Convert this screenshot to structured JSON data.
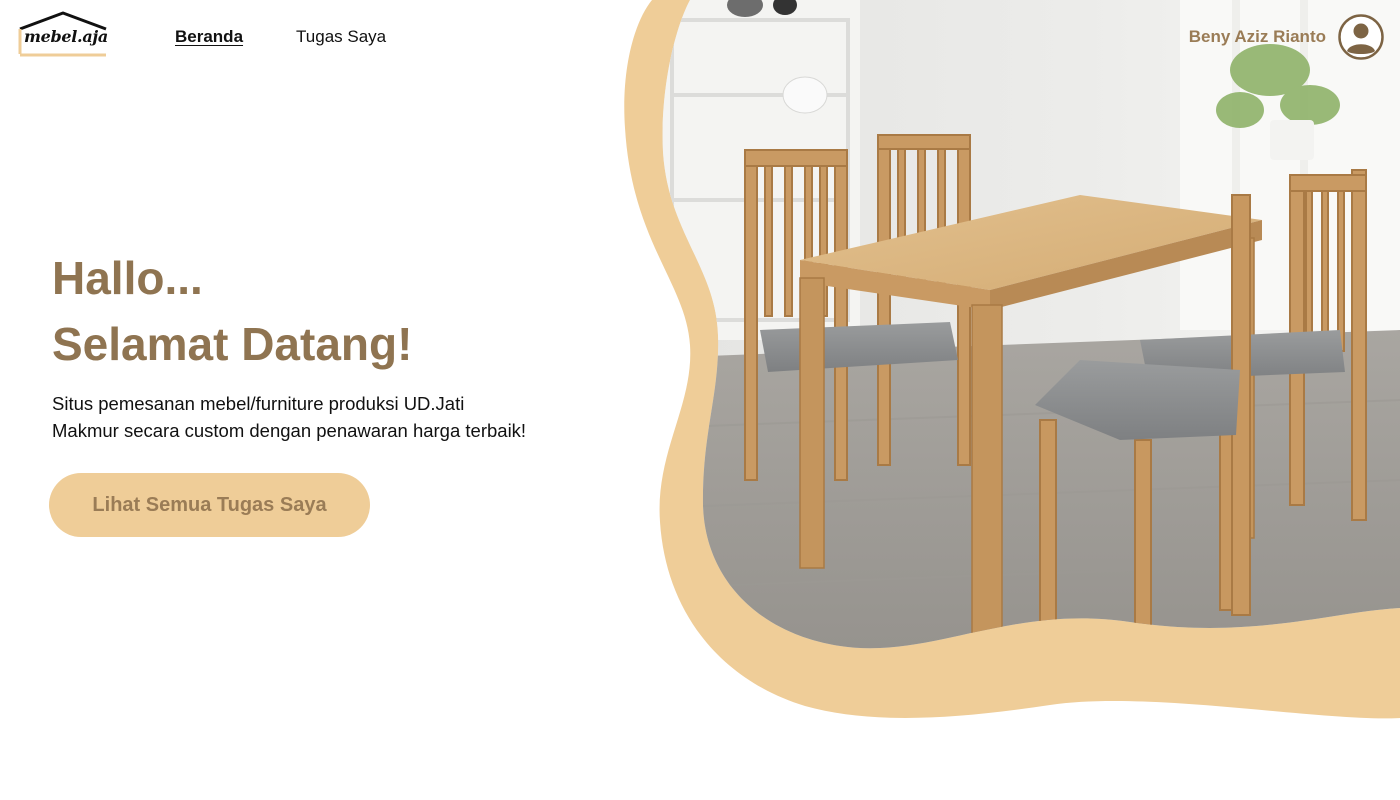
{
  "brand": {
    "logo_text": "mebel.aja"
  },
  "nav": {
    "items": [
      {
        "label": "Beranda",
        "active": true
      },
      {
        "label": "Tugas Saya",
        "active": false
      }
    ]
  },
  "user": {
    "name": "Beny Aziz Rianto",
    "avatar_icon": "user-circle-icon"
  },
  "hero": {
    "greeting": "Hallo...",
    "welcome": "Selamat Datang!",
    "description": "Situs  pemesanan mebel/furniture produksi UD.Jati\nMakmur secara custom dengan penawaran harga terbaik!",
    "cta_label": "Lihat Semua Tugas Saya",
    "image_subject": "wooden dining table with four chairs"
  },
  "colors": {
    "accent": "#efcd98",
    "brand_brown": "#8f7451",
    "text": "#111111"
  }
}
